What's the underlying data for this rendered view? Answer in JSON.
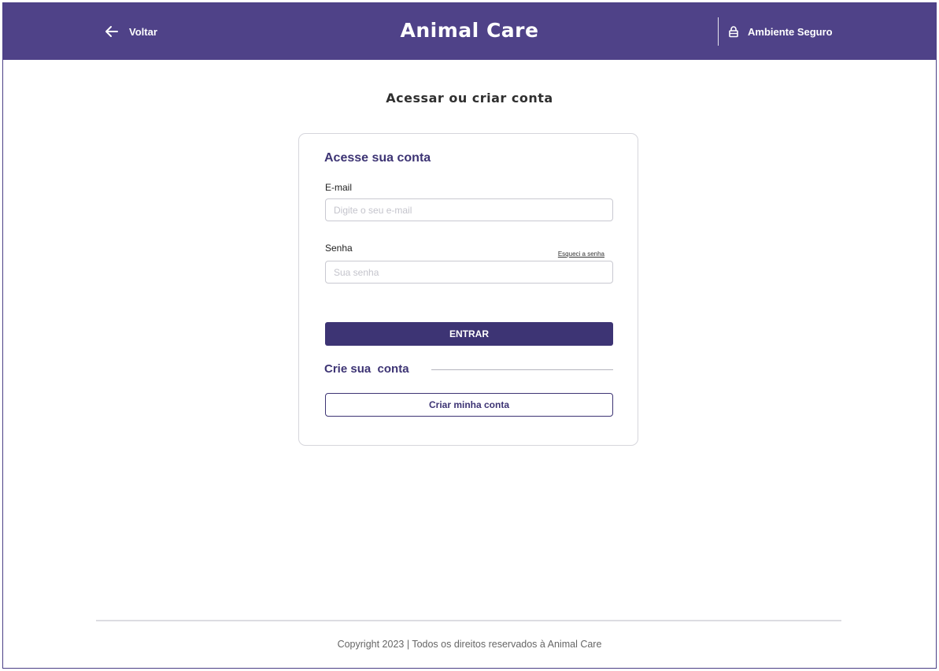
{
  "header": {
    "back_label": "Voltar",
    "brand": "Animal Care",
    "secure_label": "Ambiente Seguro",
    "background_color": "#4f4288"
  },
  "page_title": "Acessar ou criar conta",
  "login": {
    "title": "Acesse sua conta",
    "email_label": "E-mail",
    "email_placeholder": "Digite o seu e-mail",
    "email_value": "",
    "password_label": "Senha",
    "password_placeholder": "Sua senha",
    "password_value": "",
    "forgot_label": "Esqueci a senha",
    "submit_label": "ENTRAR"
  },
  "signup": {
    "title": "Crie sua  conta",
    "button_label": "Criar minha conta"
  },
  "footer": {
    "copyright": "Copyright 2023 | Todos os direitos reservados à Animal Care"
  },
  "icons": {
    "back": "arrow-left-icon",
    "secure": "lock-icon"
  },
  "colors": {
    "primary": "#3d3474",
    "header": "#4f4288"
  }
}
